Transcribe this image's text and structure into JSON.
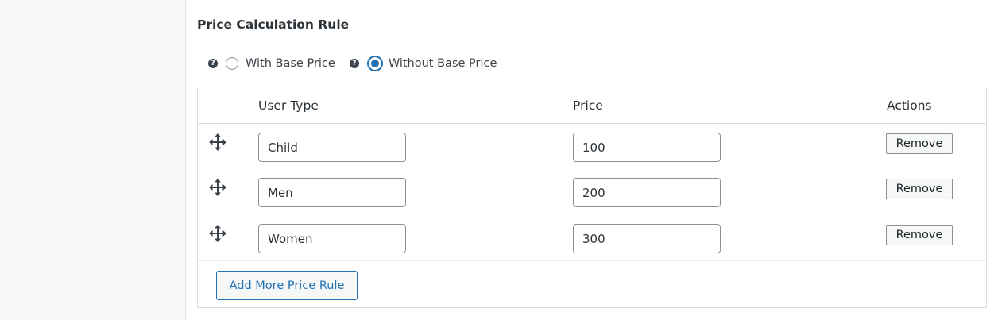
{
  "section": {
    "title": "Price Calculation Rule"
  },
  "radio_options": [
    {
      "label": "With Base Price",
      "checked": false
    },
    {
      "label": "Without Base Price",
      "checked": true
    }
  ],
  "table": {
    "headers": {
      "user_type": "User Type",
      "price": "Price",
      "actions": "Actions"
    },
    "rows": [
      {
        "user_type": "Child",
        "price": "100",
        "action_label": "Remove"
      },
      {
        "user_type": "Men",
        "price": "200",
        "action_label": "Remove"
      },
      {
        "user_type": "Women",
        "price": "300",
        "action_label": "Remove"
      }
    ]
  },
  "add_button_label": "Add More Price Rule",
  "icons": {
    "help": "help-icon",
    "drag": "move-icon"
  },
  "colors": {
    "accent": "#2271b1",
    "border": "#dcdcde",
    "text": "#2c3338"
  }
}
